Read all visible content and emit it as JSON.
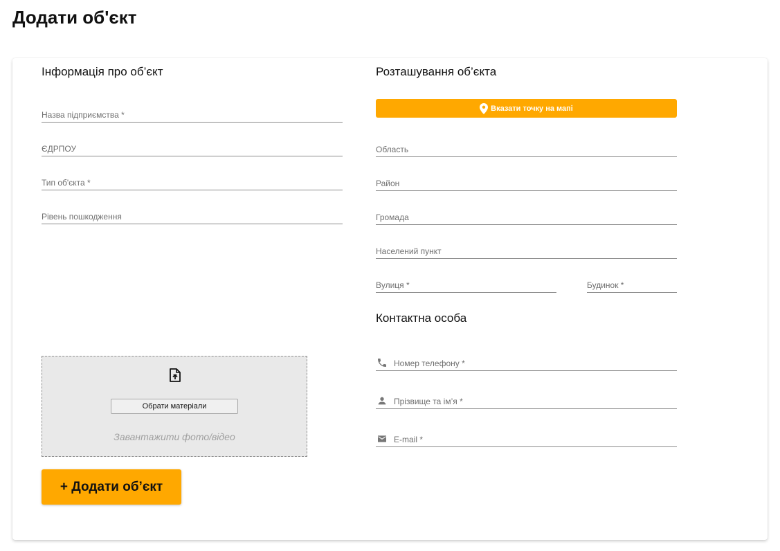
{
  "page": {
    "title": "Додати об'єкт"
  },
  "object_info": {
    "title": "Інформація про об’єкт",
    "company_name_placeholder": "Назва підприємства *",
    "edrpou_placeholder": "ЄДРПОУ",
    "object_type_placeholder": "Тип об'єкта *",
    "damage_level_placeholder": "Рівень пошкодження"
  },
  "location": {
    "title": "Розташування об’єкта",
    "map_button_label": "Вказати точку на мапі",
    "region_placeholder": "Область",
    "district_placeholder": "Район",
    "community_placeholder": "Громада",
    "settlement_placeholder": "Населений пункт",
    "street_placeholder": "Вулиця *",
    "building_placeholder": "Будинок *"
  },
  "contact": {
    "title": "Контактна особа",
    "phone_placeholder": "Номер телефону *",
    "name_placeholder": "Прізвище та ім’я *",
    "email_placeholder": "E-mail *"
  },
  "upload": {
    "choose_button_label": "Обрати матеріали",
    "hint": "Завантажити фото/відео"
  },
  "submit": {
    "label": "+ Додати об’єкт"
  },
  "colors": {
    "accent": "#ffa800",
    "field_line": "#8a8a8a",
    "upload_bg": "#e9e9e9"
  },
  "icons": {
    "map_button": "map-pin-icon",
    "phone": "phone-icon",
    "person": "person-icon",
    "email": "email-icon",
    "upload": "file-upload-icon"
  }
}
